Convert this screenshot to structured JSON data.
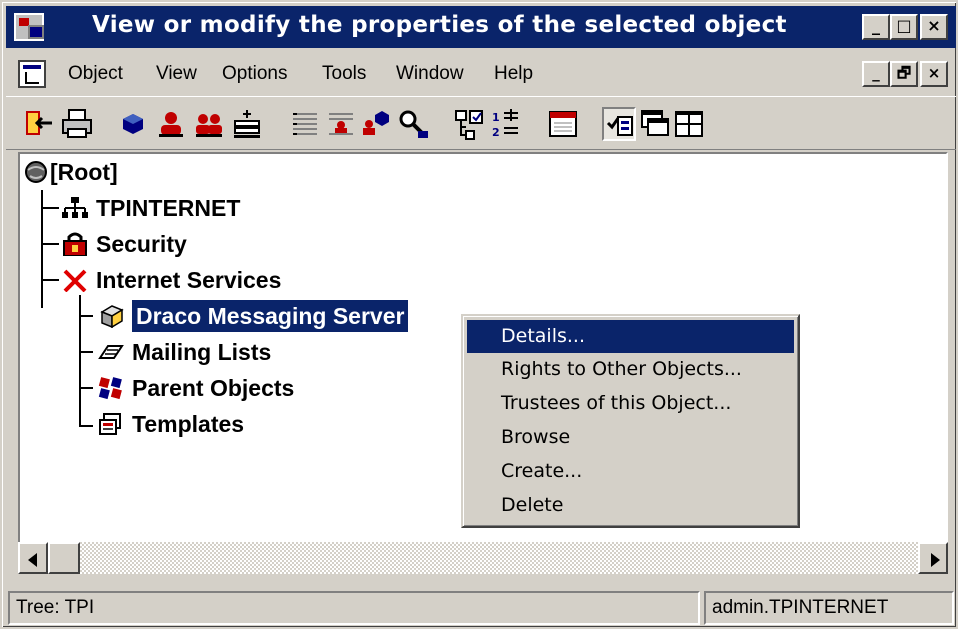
{
  "window": {
    "title": "View or modify the properties of the selected object",
    "min_label": "_",
    "max_label": "□",
    "close_label": "×"
  },
  "menubar": {
    "items": [
      "Object",
      "View",
      "Options",
      "Tools",
      "Window",
      "Help"
    ],
    "min_label": "_",
    "restore_label": "🗗",
    "close_label": "×"
  },
  "toolbar": {
    "buttons": [
      "exit",
      "print",
      "create-object",
      "user",
      "group",
      "add-user",
      "details",
      "rights",
      "trustees",
      "search",
      "tree-view",
      "sort",
      "calendar",
      "check",
      "windows",
      "tile"
    ]
  },
  "tree": {
    "root": "[Root]",
    "nodes": [
      "TPINTERNET",
      "Security",
      "Internet Services",
      "Draco Messaging Server",
      "Mailing Lists",
      "Parent Objects",
      "Templates"
    ]
  },
  "context_menu": {
    "items": [
      "Details...",
      "Rights to Other Objects...",
      "Trustees of this Object...",
      "Browse",
      "Create...",
      "Delete"
    ],
    "active_index": 0
  },
  "statusbar": {
    "tree": "Tree: TPI",
    "user": "admin.TPINTERNET"
  },
  "colors": {
    "titlebar": "#0a246a",
    "face": "#d4d0c8",
    "highlight": "#0a246a"
  }
}
